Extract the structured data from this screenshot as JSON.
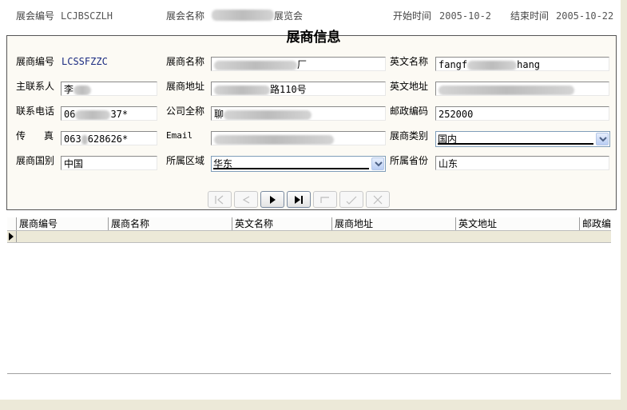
{
  "header": {
    "fair_no_label": "展会编号",
    "fair_no_value": "LCJBSCZLH",
    "fair_name_label": "展会名称",
    "fair_name_suffix": "展览会",
    "start_label": "开始时间",
    "start_value": "2005-10-2",
    "end_label": "结束时间",
    "end_value": "2005-10-22"
  },
  "panel": {
    "title": "展商信息"
  },
  "form": {
    "exhibitor_no_label": "展商编号",
    "exhibitor_no_value": "LCSSFZZC",
    "exhibitor_name_label": "展商名称",
    "exhibitor_name_tail": "厂",
    "english_name_label": "英文名称",
    "english_name_head": "fangf",
    "english_name_tail": "hang",
    "contact_label": "主联系人",
    "contact_head": "李",
    "exhibitor_addr_label": "展商地址",
    "exhibitor_addr_tail": "路110号",
    "english_addr_label": "英文地址",
    "phone_label": "联系电话",
    "phone_head": "06",
    "phone_tail": "37*",
    "company_label": "公司全称",
    "company_head": "聊",
    "postcode_label": "邮政编码",
    "postcode_value": "252000",
    "fax_label_1": "传",
    "fax_label_2": "真",
    "fax_head": "063",
    "fax_tail": "628626*",
    "email_label": "Email",
    "category_label": "展商类别",
    "category_value": "国内",
    "country_label": "展商国别",
    "country_value": "中国",
    "region_label": "所属区域",
    "region_value": "华东",
    "province_label": "所属省份",
    "province_value": "山东"
  },
  "nav": [
    "first",
    "prev",
    "next",
    "last",
    "insert",
    "post",
    "cancel"
  ],
  "grid": {
    "columns": [
      "展商编号",
      "展商名称",
      "英文名称",
      "展商地址",
      "英文地址",
      "邮政编码"
    ]
  }
}
